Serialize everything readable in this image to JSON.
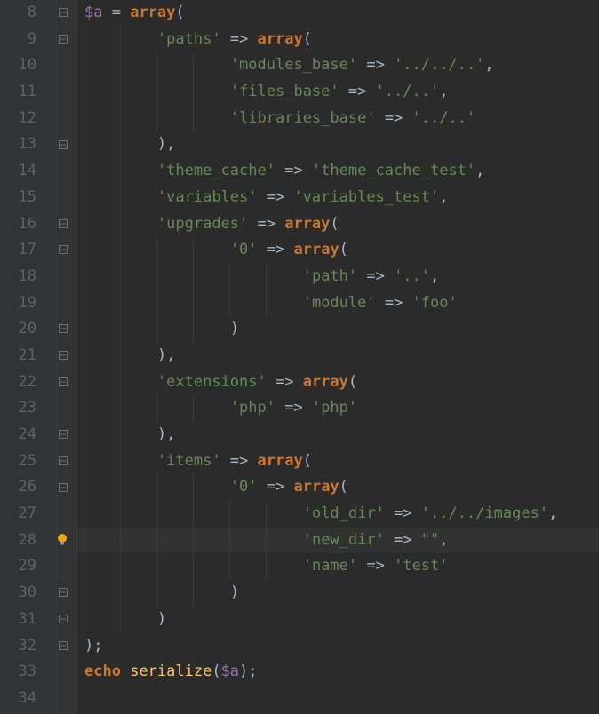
{
  "colors": {
    "bg": "#2b2b2b",
    "gutter_bg": "#313335",
    "gutter_fg": "#5e6366",
    "keyword": "#cc7832",
    "string": "#6a8759",
    "variable": "#9876aa",
    "func": "#ffc66d",
    "punct": "#a9b7c6",
    "highlight_line_bg": "#323232"
  },
  "first_line_no": 8,
  "highlight_line": 28,
  "bulb_line": 28,
  "fold_markers": [
    {
      "line": 8,
      "type": "open"
    },
    {
      "line": 9,
      "type": "open"
    },
    {
      "line": 13,
      "type": "close"
    },
    {
      "line": 16,
      "type": "open"
    },
    {
      "line": 17,
      "type": "open"
    },
    {
      "line": 20,
      "type": "close"
    },
    {
      "line": 21,
      "type": "close"
    },
    {
      "line": 22,
      "type": "open"
    },
    {
      "line": 24,
      "type": "close"
    },
    {
      "line": 25,
      "type": "open"
    },
    {
      "line": 26,
      "type": "open"
    },
    {
      "line": 30,
      "type": "close"
    },
    {
      "line": 31,
      "type": "close"
    },
    {
      "line": 32,
      "type": "close"
    }
  ],
  "code": [
    {
      "line": 8,
      "indent": 0,
      "segs": [
        [
          "var",
          "$a"
        ],
        [
          "punc",
          " = "
        ],
        [
          "kw",
          "array"
        ],
        [
          "punc",
          "("
        ]
      ]
    },
    {
      "line": 9,
      "indent": 2,
      "segs": [
        [
          "str",
          "'paths'"
        ],
        [
          "punc",
          " => "
        ],
        [
          "kw",
          "array"
        ],
        [
          "punc",
          "("
        ]
      ]
    },
    {
      "line": 10,
      "indent": 4,
      "segs": [
        [
          "str",
          "'modules_base'"
        ],
        [
          "punc",
          " => "
        ],
        [
          "str",
          "'../../..'"
        ],
        [
          "punc",
          ","
        ]
      ]
    },
    {
      "line": 11,
      "indent": 4,
      "segs": [
        [
          "str",
          "'files_base'"
        ],
        [
          "punc",
          " => "
        ],
        [
          "str",
          "'../..'"
        ],
        [
          "punc",
          ","
        ]
      ]
    },
    {
      "line": 12,
      "indent": 4,
      "segs": [
        [
          "str",
          "'libraries_base'"
        ],
        [
          "punc",
          " => "
        ],
        [
          "str",
          "'../..'"
        ]
      ]
    },
    {
      "line": 13,
      "indent": 2,
      "segs": [
        [
          "punc",
          ")"
        ],
        [
          "punc",
          ","
        ]
      ]
    },
    {
      "line": 14,
      "indent": 2,
      "segs": [
        [
          "str",
          "'theme_cache'"
        ],
        [
          "punc",
          " => "
        ],
        [
          "str",
          "'theme_cache_test'"
        ],
        [
          "punc",
          ","
        ]
      ]
    },
    {
      "line": 15,
      "indent": 2,
      "segs": [
        [
          "str",
          "'variables'"
        ],
        [
          "punc",
          " => "
        ],
        [
          "str",
          "'variables_test'"
        ],
        [
          "punc",
          ","
        ]
      ]
    },
    {
      "line": 16,
      "indent": 2,
      "segs": [
        [
          "str",
          "'upgrades'"
        ],
        [
          "punc",
          " => "
        ],
        [
          "kw",
          "array"
        ],
        [
          "punc",
          "("
        ]
      ]
    },
    {
      "line": 17,
      "indent": 4,
      "segs": [
        [
          "str",
          "'0'"
        ],
        [
          "punc",
          " => "
        ],
        [
          "kw",
          "array"
        ],
        [
          "punc",
          "("
        ]
      ]
    },
    {
      "line": 18,
      "indent": 6,
      "segs": [
        [
          "str",
          "'path'"
        ],
        [
          "punc",
          " => "
        ],
        [
          "str",
          "'..'"
        ],
        [
          "punc",
          ","
        ]
      ]
    },
    {
      "line": 19,
      "indent": 6,
      "segs": [
        [
          "str",
          "'module'"
        ],
        [
          "punc",
          " => "
        ],
        [
          "str",
          "'foo'"
        ]
      ]
    },
    {
      "line": 20,
      "indent": 4,
      "segs": [
        [
          "punc",
          ")"
        ]
      ]
    },
    {
      "line": 21,
      "indent": 2,
      "segs": [
        [
          "punc",
          ")"
        ],
        [
          "punc",
          ","
        ]
      ]
    },
    {
      "line": 22,
      "indent": 2,
      "segs": [
        [
          "str",
          "'extensions'"
        ],
        [
          "punc",
          " => "
        ],
        [
          "kw",
          "array"
        ],
        [
          "punc",
          "("
        ]
      ]
    },
    {
      "line": 23,
      "indent": 4,
      "segs": [
        [
          "str",
          "'php'"
        ],
        [
          "punc",
          " => "
        ],
        [
          "str",
          "'php'"
        ]
      ]
    },
    {
      "line": 24,
      "indent": 2,
      "segs": [
        [
          "punc",
          ")"
        ],
        [
          "punc",
          ","
        ]
      ]
    },
    {
      "line": 25,
      "indent": 2,
      "segs": [
        [
          "str",
          "'items'"
        ],
        [
          "punc",
          " => "
        ],
        [
          "kw",
          "array"
        ],
        [
          "punc",
          "("
        ]
      ]
    },
    {
      "line": 26,
      "indent": 4,
      "segs": [
        [
          "str",
          "'0'"
        ],
        [
          "punc",
          " => "
        ],
        [
          "kw",
          "array"
        ],
        [
          "punc",
          "("
        ]
      ]
    },
    {
      "line": 27,
      "indent": 6,
      "segs": [
        [
          "str",
          "'old_dir'"
        ],
        [
          "punc",
          " => "
        ],
        [
          "str",
          "'../../images'"
        ],
        [
          "punc",
          ","
        ]
      ]
    },
    {
      "line": 28,
      "indent": 6,
      "segs": [
        [
          "str",
          "'new_dir'"
        ],
        [
          "punc",
          " => "
        ],
        [
          "str",
          "\"\""
        ],
        [
          "punc",
          ","
        ]
      ]
    },
    {
      "line": 29,
      "indent": 6,
      "segs": [
        [
          "str",
          "'name'"
        ],
        [
          "punc",
          " => "
        ],
        [
          "str",
          "'test'"
        ]
      ]
    },
    {
      "line": 30,
      "indent": 4,
      "segs": [
        [
          "punc",
          ")"
        ]
      ]
    },
    {
      "line": 31,
      "indent": 2,
      "segs": [
        [
          "punc",
          ")"
        ]
      ]
    },
    {
      "line": 32,
      "indent": 0,
      "segs": [
        [
          "punc",
          ");"
        ]
      ]
    },
    {
      "line": 33,
      "indent": 0,
      "segs": [
        [
          "kw",
          "echo "
        ],
        [
          "fn",
          "serialize"
        ],
        [
          "punc",
          "("
        ],
        [
          "var",
          "$a"
        ],
        [
          "punc",
          ");"
        ]
      ]
    },
    {
      "line": 34,
      "indent": 0,
      "segs": []
    }
  ]
}
